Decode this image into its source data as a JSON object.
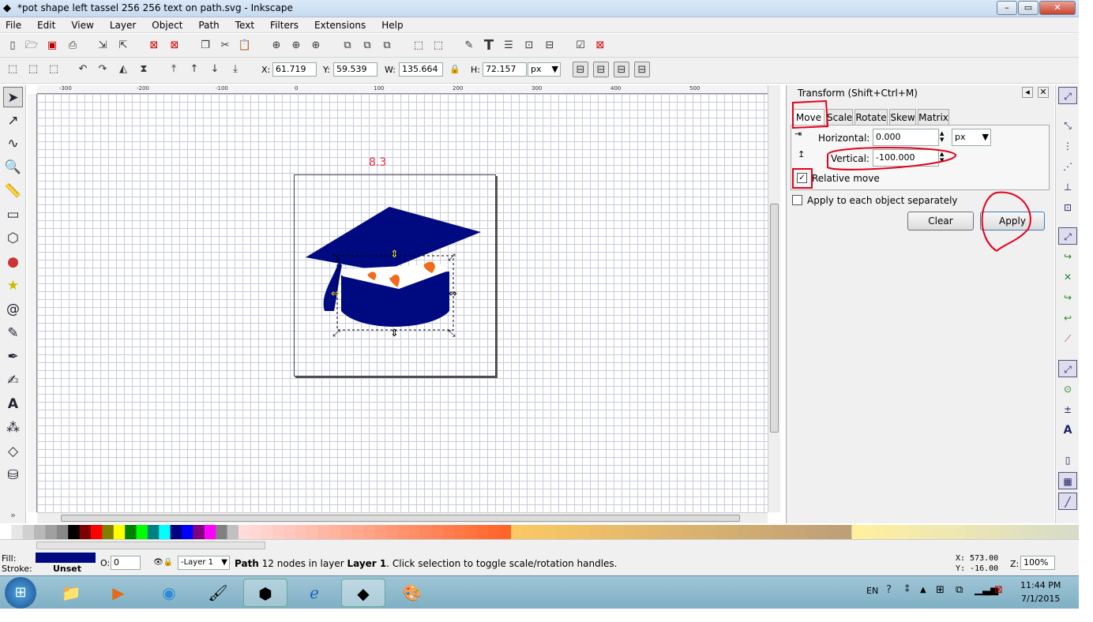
{
  "window": {
    "title": "*pot shape left tassel 256 256 text on path.svg - Inkscape"
  },
  "menu": [
    "File",
    "Edit",
    "View",
    "Layer",
    "Object",
    "Path",
    "Text",
    "Filters",
    "Extensions",
    "Help"
  ],
  "toolbar": {
    "x_label": "X:",
    "x_value": "61.719",
    "y_label": "Y:",
    "y_value": "59.539",
    "w_label": "W:",
    "w_value": "135.664",
    "h_label": "H:",
    "h_value": "72.157",
    "unit": "px"
  },
  "canvas": {
    "page_label": "8.3"
  },
  "ruler": {
    "ticks": [
      "-300",
      "-200",
      "-100",
      "0",
      "100",
      "200",
      "300",
      "400",
      "500"
    ]
  },
  "transform": {
    "title": "Transform (Shift+Ctrl+M)",
    "tabs": [
      "Move",
      "Scale",
      "Rotate",
      "Skew",
      "Matrix"
    ],
    "horizontal_label": "Horizontal:",
    "horizontal_value": "0.000",
    "unit": "px",
    "vertical_label": "Vertical:",
    "vertical_value": "-100.000",
    "relative_move": "Relative move",
    "apply_each": "Apply to each object separately",
    "clear": "Clear",
    "apply": "Apply"
  },
  "status": {
    "fill_label": "Fill:",
    "stroke_label": "Stroke:",
    "stroke_value": "Unset",
    "opacity_label": "O:",
    "opacity_value": "0",
    "layer": "-Layer 1",
    "message_bold1": "Path",
    "message_mid": " 12 nodes in layer ",
    "message_bold2": "Layer 1",
    "message_end": ". Click selection to toggle scale/rotation handles.",
    "coord_x": "X:  573.00",
    "coord_y": "Y:  -16.00",
    "zoom_label": "Z:",
    "zoom_value": "100%"
  },
  "taskbar": {
    "lang": "EN",
    "time": "11:44 PM",
    "date": "7/1/2015"
  },
  "colors": {
    "cap": "#000a80",
    "accent": "#f06b1c",
    "annotation": "#e4001b",
    "page_label": "#e8293a"
  }
}
